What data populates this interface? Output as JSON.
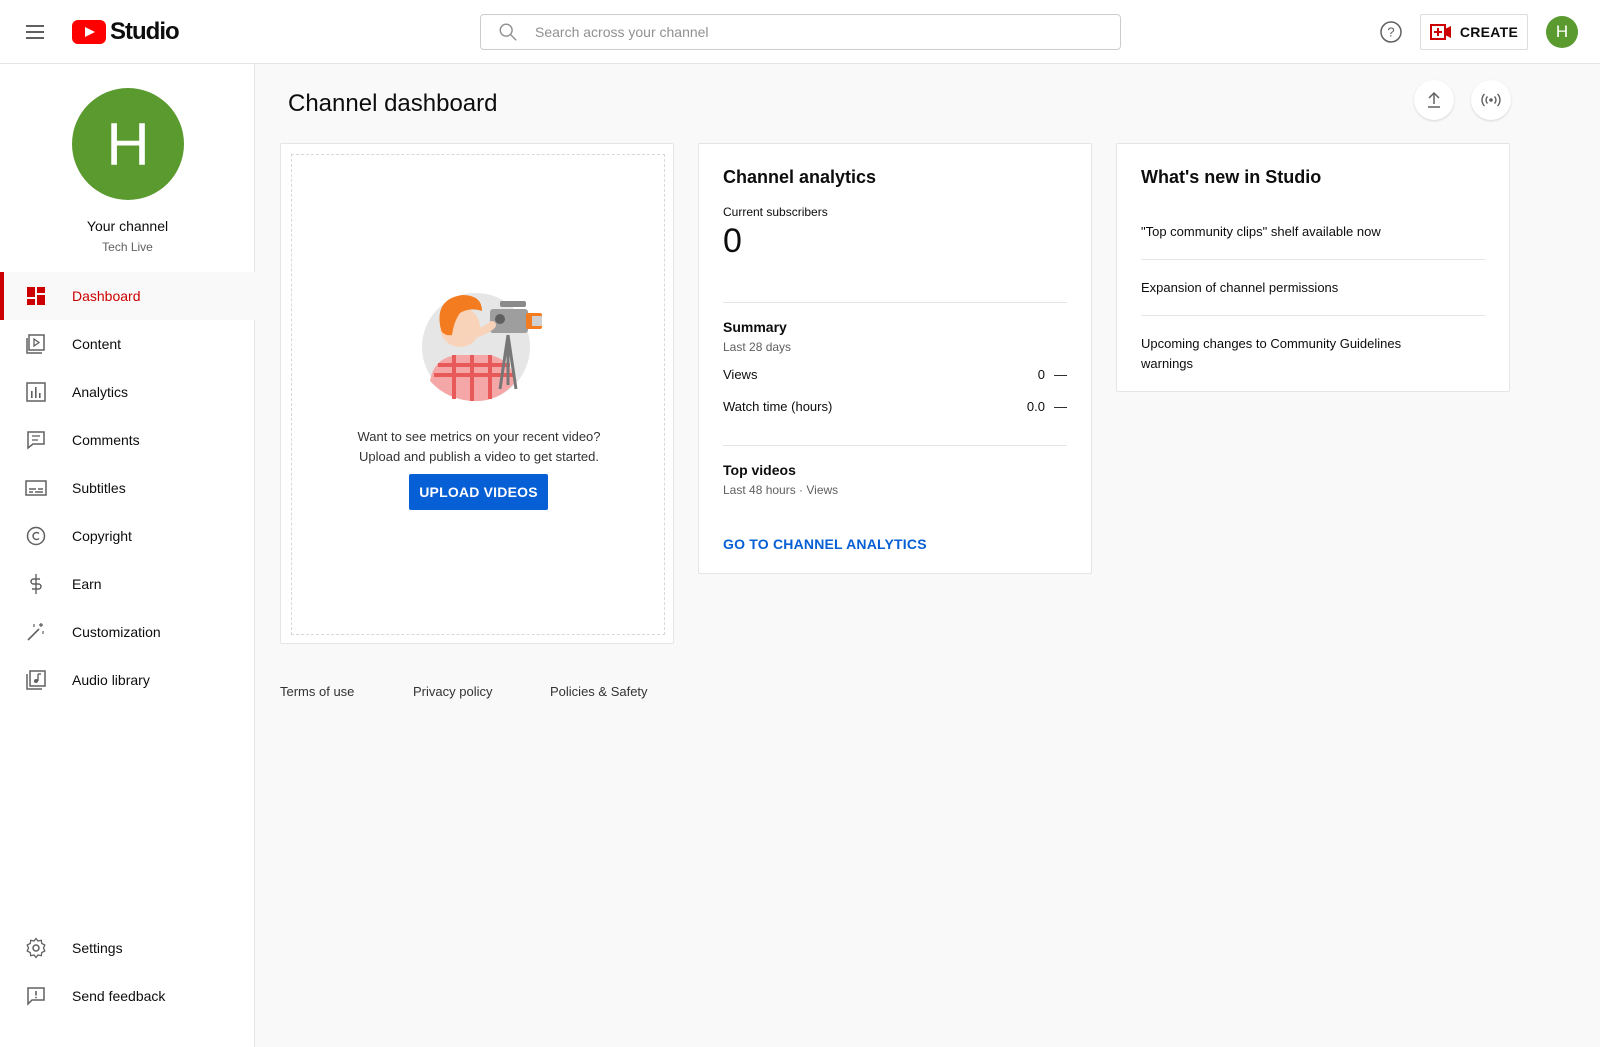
{
  "header": {
    "logo_text": "Studio",
    "search_placeholder": "Search across your channel",
    "create_label": "CREATE",
    "avatar_letter": "H"
  },
  "sidebar": {
    "avatar_letter": "H",
    "channel_title": "Your channel",
    "channel_name": "Tech Live",
    "items": [
      {
        "label": "Dashboard",
        "icon": "dashboard-icon",
        "active": true
      },
      {
        "label": "Content",
        "icon": "content-icon"
      },
      {
        "label": "Analytics",
        "icon": "analytics-icon"
      },
      {
        "label": "Comments",
        "icon": "comments-icon"
      },
      {
        "label": "Subtitles",
        "icon": "subtitles-icon"
      },
      {
        "label": "Copyright",
        "icon": "copyright-icon"
      },
      {
        "label": "Earn",
        "icon": "earn-icon"
      },
      {
        "label": "Customization",
        "icon": "customization-icon"
      },
      {
        "label": "Audio library",
        "icon": "audio-library-icon"
      }
    ],
    "bottom_items": [
      {
        "label": "Settings",
        "icon": "settings-icon"
      },
      {
        "label": "Send feedback",
        "icon": "feedback-icon"
      }
    ]
  },
  "main": {
    "page_title": "Channel dashboard",
    "upload_card": {
      "line1": "Want to see metrics on your recent video?",
      "line2": "Upload and publish a video to get started.",
      "button_label": "UPLOAD VIDEOS"
    },
    "analytics_card": {
      "title": "Channel analytics",
      "subscribers_label": "Current subscribers",
      "subscribers_value": "0",
      "summary_title": "Summary",
      "summary_period": "Last 28 days",
      "rows": [
        {
          "label": "Views",
          "value": "0",
          "change": "—"
        },
        {
          "label": "Watch time (hours)",
          "value": "0.0",
          "change": "—"
        }
      ],
      "top_videos_title": "Top videos",
      "top_videos_period": "Last 48 hours · Views",
      "link_label": "GO TO CHANNEL ANALYTICS"
    },
    "news_card": {
      "title": "What's new in Studio",
      "items": [
        "\"Top community clips\" shelf available now",
        "Expansion of channel permissions",
        "Upcoming changes to Community Guidelines warnings"
      ]
    }
  },
  "footer": {
    "links": [
      "Terms of use",
      "Privacy policy",
      "Policies & Safety"
    ]
  },
  "colors": {
    "accent_red": "#cc0000",
    "link_blue": "#065fd4",
    "avatar_green": "#5a9a2f"
  }
}
